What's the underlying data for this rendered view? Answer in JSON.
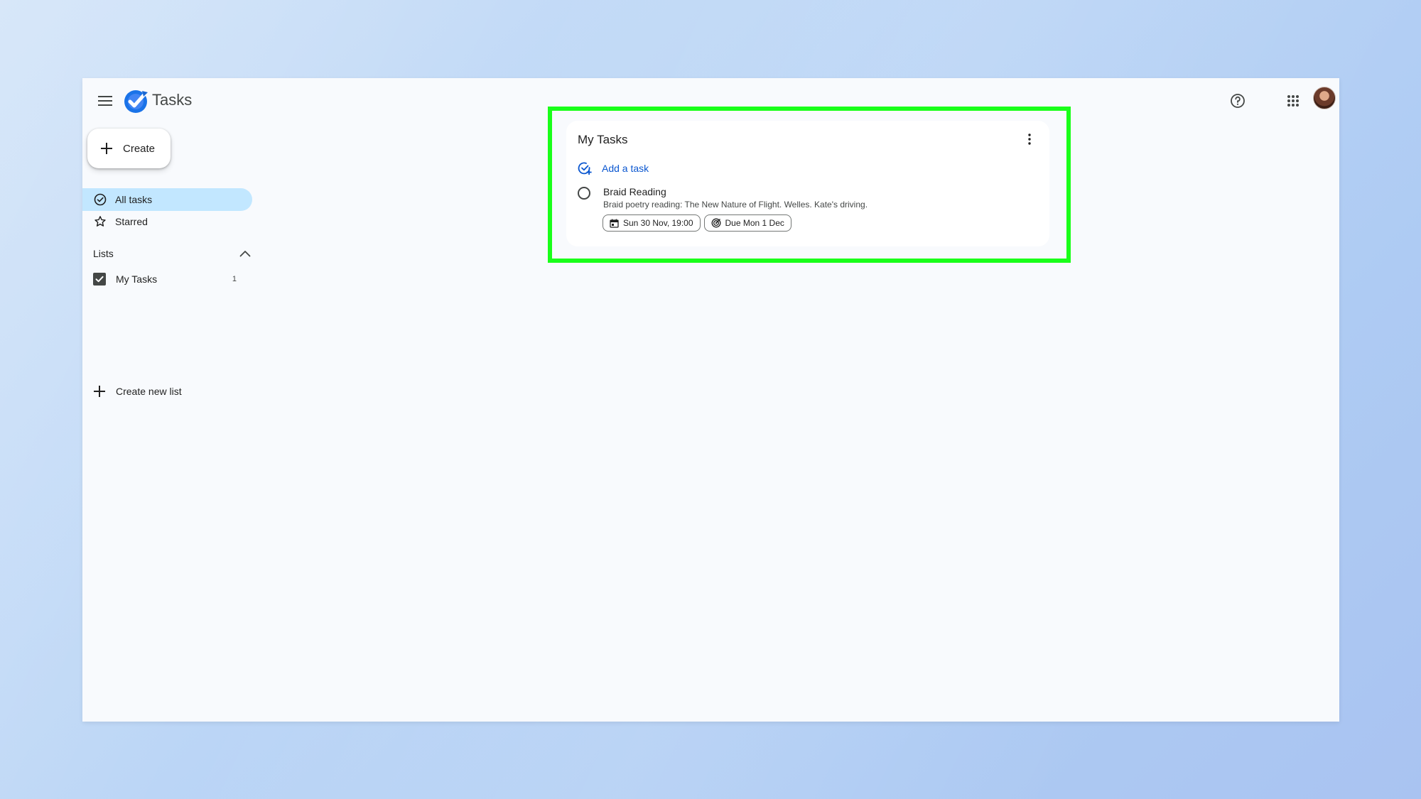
{
  "app": {
    "title": "Tasks"
  },
  "header": {
    "menu_icon": "hamburger-menu-icon",
    "help_icon": "help-circle-icon",
    "apps_icon": "apps-grid-icon"
  },
  "sidebar": {
    "create_label": "Create",
    "nav": [
      {
        "label": "All tasks",
        "icon": "check-circle-icon",
        "selected": true
      },
      {
        "label": "Starred",
        "icon": "star-icon",
        "selected": false
      }
    ],
    "lists_heading": "Lists",
    "lists": [
      {
        "label": "My Tasks",
        "count": "1",
        "checked": true
      }
    ],
    "create_list_label": "Create new list"
  },
  "main": {
    "card": {
      "title": "My Tasks",
      "add_task_label": "Add a task",
      "tasks": [
        {
          "title": "Braid Reading",
          "description": "Braid poetry reading: The New Nature of Flight. Welles. Kate's driving.",
          "date_chip": "Sun 30 Nov, 19:00",
          "due_chip": "Due Mon 1 Dec"
        }
      ]
    }
  },
  "colors": {
    "accent": "#0b57d0",
    "selected_nav": "#c2e7ff",
    "highlight": "#1aff1a"
  }
}
